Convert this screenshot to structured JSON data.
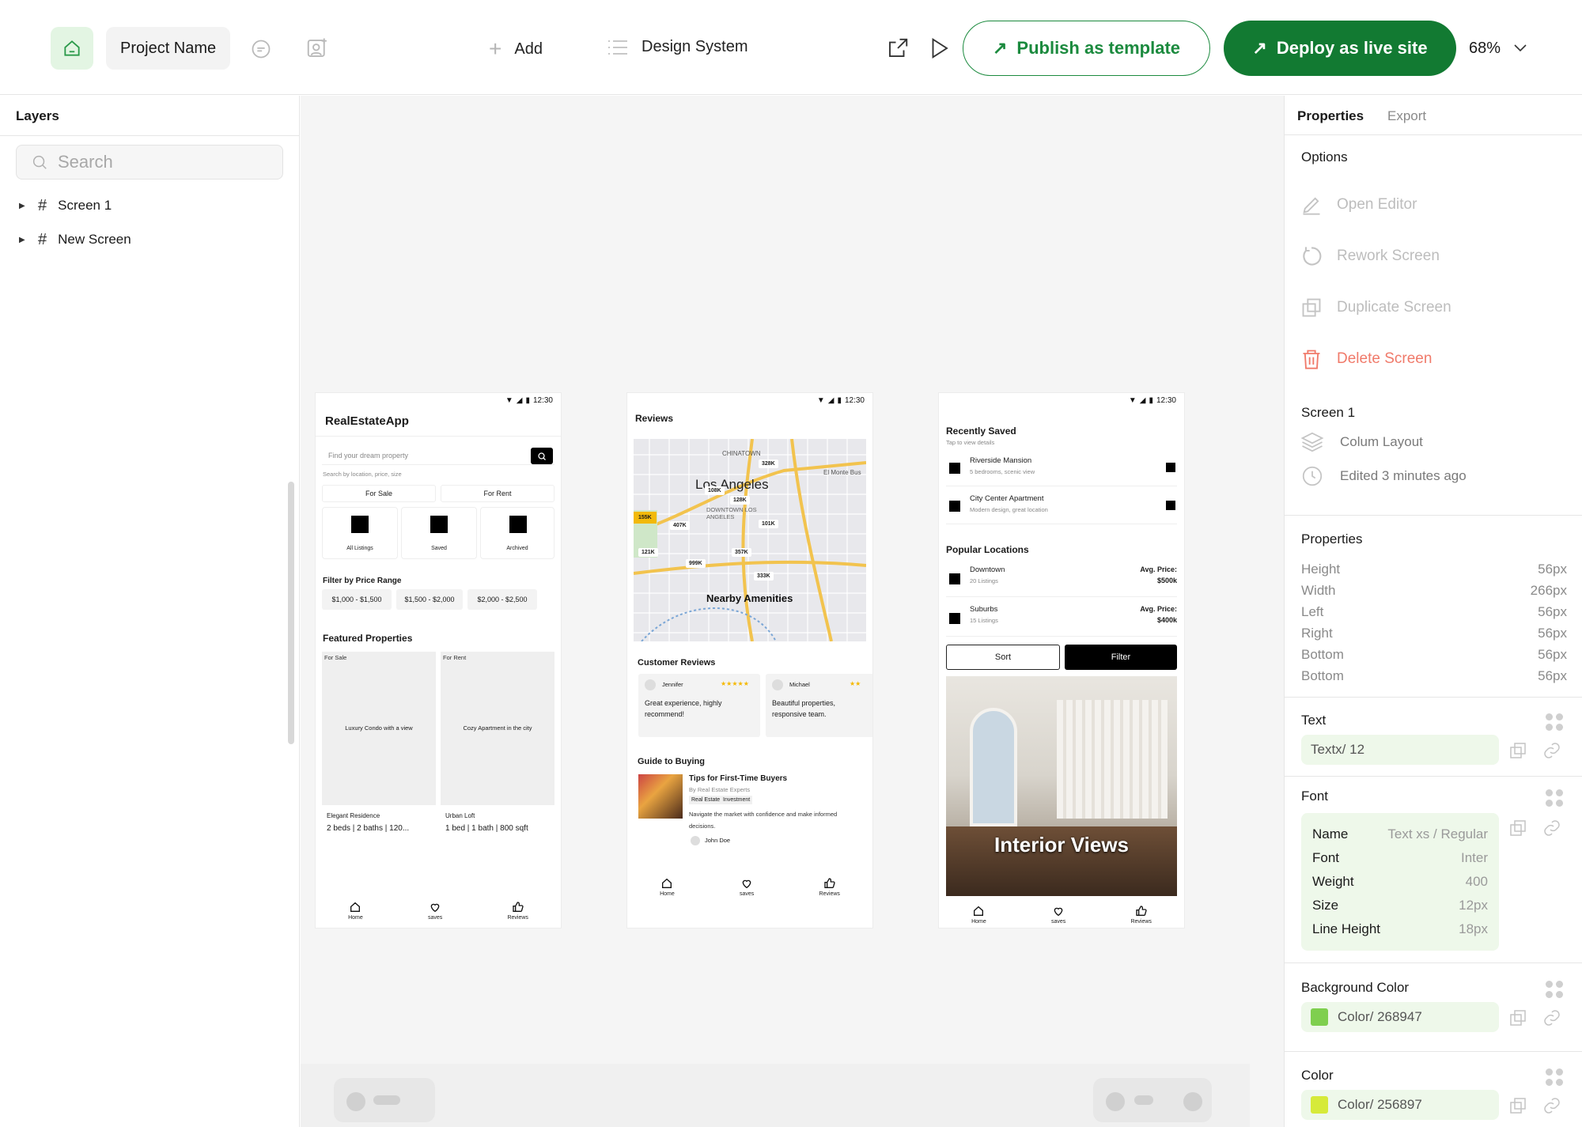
{
  "topbar": {
    "project_name": "Project Name",
    "add_label": "Add",
    "design_system_label": "Design System",
    "publish_label": "Publish as template",
    "deploy_label": "Deploy as live site",
    "zoom": "68%"
  },
  "left_panel": {
    "title": "Layers",
    "search_placeholder": "Search",
    "layers": [
      {
        "label": "Screen 1"
      },
      {
        "label": "New Screen"
      }
    ]
  },
  "screens": {
    "status_time": "12:30",
    "s1": {
      "app_title": "RealEstateApp",
      "search_placeholder": "Find your dream property",
      "search_hint": "Search by location, price, size",
      "tabs": [
        "For Sale",
        "For Rent"
      ],
      "categories": [
        "All Listings",
        "Saved",
        "Archived"
      ],
      "filter_title": "Filter by Price Range",
      "price_ranges": [
        "$1,000 - $1,500",
        "$1,500 - $2,000",
        "$2,000 - $2,500"
      ],
      "featured_title": "Featured Properties",
      "properties": [
        {
          "badge": "For Sale",
          "image_label": "Luxury Condo with a view",
          "name": "Elegant Residence",
          "details": "2 beds | 2 baths | 120..."
        },
        {
          "badge": "For Rent",
          "image_label": "Cozy Apartment in the city",
          "name": "Urban Loft",
          "details": "1 bed | 1 bath | 800 sqft"
        }
      ]
    },
    "s2": {
      "title": "Reviews",
      "map_labels": [
        "CHINATOWN",
        "Los Angeles",
        "DOWNTOWN LOS ANGELES",
        "El Monte Bus"
      ],
      "map_prices": [
        "328K",
        "108K",
        "128K",
        "155K",
        "407K",
        "101K",
        "121K",
        "357K",
        "999K",
        "333K"
      ],
      "map_caption": "Nearby Amenities",
      "reviews_title": "Customer Reviews",
      "reviews": [
        {
          "name": "Jennifer",
          "stars": "★★★★★",
          "text": "Great experience, highly recommend!"
        },
        {
          "name": "Michael",
          "stars": "★★",
          "text": "Beautiful properties, responsive team."
        }
      ],
      "guide_title": "Guide to Buying",
      "article": {
        "title": "Tips for First-Time Buyers",
        "byline": "By Real Estate Experts",
        "tags": [
          "Real Estate",
          "Investment"
        ],
        "desc": "Navigate the market with confidence and make informed decisions.",
        "author": "John Doe"
      }
    },
    "s3": {
      "recent_title": "Recently Saved",
      "recent_sub": "Tap to view details",
      "saved": [
        {
          "name": "Riverside Mansion",
          "desc": "5 bedrooms, scenic view"
        },
        {
          "name": "City Center Apartment",
          "desc": "Modern design, great location"
        }
      ],
      "popular_title": "Popular Locations",
      "locations": [
        {
          "name": "Downtown",
          "count": "20 Listings",
          "price_label": "Avg. Price:",
          "price": "$500k"
        },
        {
          "name": "Suburbs",
          "count": "15 Listings",
          "price_label": "Avg. Price:",
          "price": "$400k"
        }
      ],
      "sort_label": "Sort",
      "filter_label": "Filter",
      "hero_caption": "Interior Views"
    },
    "tabbar": {
      "home": "Home",
      "saves": "saves",
      "reviews": "Reviews"
    }
  },
  "right_panel": {
    "tabs": [
      "Properties",
      "Export"
    ],
    "options_title": "Options",
    "options": [
      "Open Editor",
      "Rework Screen",
      "Duplicate Screen",
      "Delete Screen"
    ],
    "screen_name": "Screen 1",
    "layout": "Colum Layout",
    "edited": "Edited 3 minutes ago",
    "properties_title": "Properties",
    "props": [
      {
        "label": "Height",
        "value": "56px"
      },
      {
        "label": "Width",
        "value": "266px"
      },
      {
        "label": "Left",
        "value": "56px"
      },
      {
        "label": "Right",
        "value": "56px"
      },
      {
        "label": "Bottom",
        "value": "56px"
      },
      {
        "label": "Bottom",
        "value": "56px"
      }
    ],
    "text_title": "Text",
    "text_value": "Textx/  12",
    "font_title": "Font",
    "font": [
      {
        "label": "Name",
        "value": "Text xs / Regular"
      },
      {
        "label": "Font",
        "value": "Inter"
      },
      {
        "label": "Weight",
        "value": "400"
      },
      {
        "label": "Size",
        "value": "12px"
      },
      {
        "label": "Line Height",
        "value": "18px"
      }
    ],
    "bg_title": "Background Color",
    "bg_value": "Color/ 268947",
    "bg_swatch": "#7fcf4f",
    "color_title": "Color",
    "color_value": "Color/ 256897",
    "color_swatch": "#d6ea3a"
  },
  "colors": {
    "accent": "#127a32",
    "danger": "#f07a6a"
  }
}
